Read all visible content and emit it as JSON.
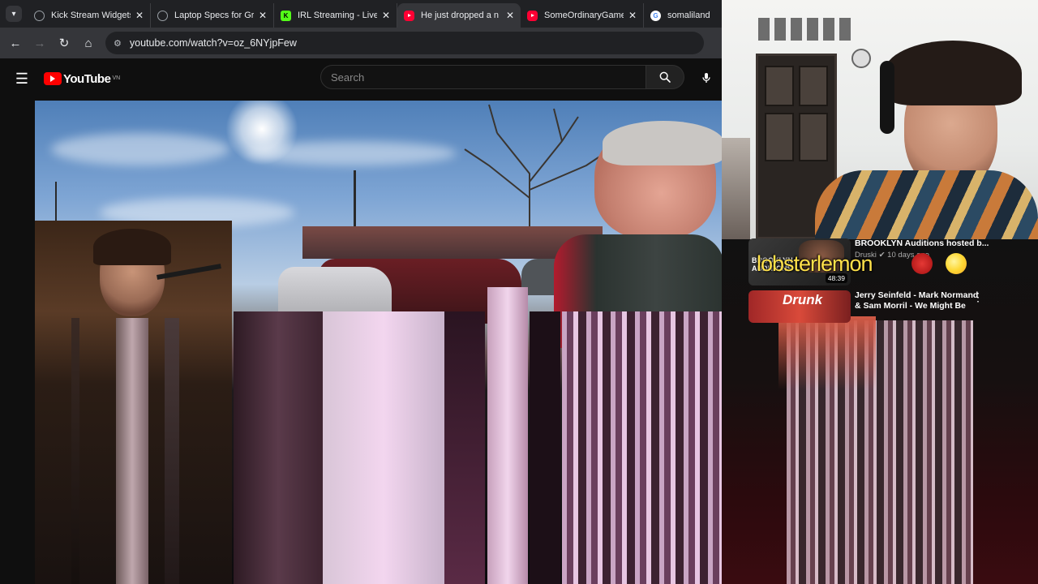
{
  "browser": {
    "tabs": [
      {
        "label": "Kick Stream Widgets",
        "favicon": "globe-icon",
        "active": false
      },
      {
        "label": "Laptop Specs for Gri",
        "favicon": "globe-icon",
        "active": false
      },
      {
        "label": "IRL Streaming - Live",
        "favicon": "kick-icon",
        "active": false
      },
      {
        "label": "He just dropped a n",
        "favicon": "youtube-icon",
        "active": true
      },
      {
        "label": "SomeOrdinaryGamer",
        "favicon": "youtube-icon",
        "active": false
      },
      {
        "label": "somaliland - Go",
        "favicon": "google-icon",
        "active": false
      }
    ],
    "url": "youtube.com/watch?v=oz_6NYjpFew"
  },
  "youtube": {
    "logo_text": "YouTube",
    "region": "VN",
    "search_placeholder": "Search"
  },
  "related": [
    {
      "title": "BROOKLYN Auditions hosted b...",
      "channel": "Druski",
      "meta": "10 days ago",
      "duration": "48:39",
      "thumb_text": "BROOKLYN AUDITIONS"
    },
    {
      "title": "Jerry Seinfeld - Mark Normand & Sam Morril - We Might Be",
      "thumb_text": "Drunk"
    }
  ],
  "overlay": {
    "text": "lobsterlemon"
  },
  "colors": {
    "chrome_bg": "#202124",
    "chrome_active": "#35363a",
    "yt_red": "#ff0000",
    "overlay_yellow": "#ffe14a"
  }
}
